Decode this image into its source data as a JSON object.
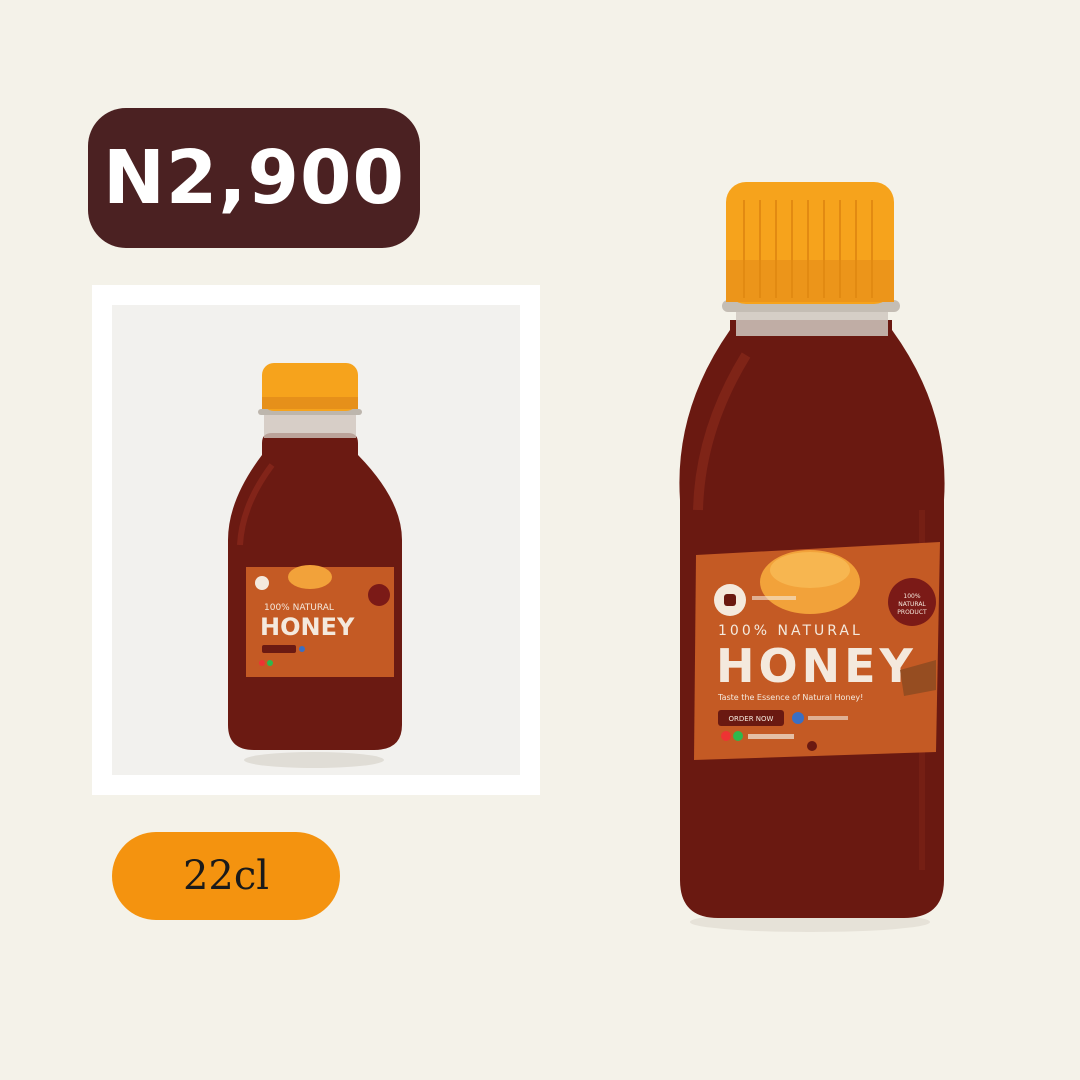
{
  "price": "N2,900",
  "volume": "22cl",
  "label": {
    "tagline": "100% NATURAL",
    "product_name": "HONEY",
    "badge": "100% NATURAL PRODUCT",
    "cta": "ORDER NOW",
    "subtitle": "Taste the Essence of Natural Honey!"
  },
  "colors": {
    "price_badge": "#4b2122",
    "volume_pill": "#f4930f",
    "background": "#f4f2e9",
    "cap": "#f6a31c",
    "honey": "#6e1a12",
    "label": "#c45a24"
  },
  "icons": [
    "phone-icon",
    "whatsapp-icon",
    "facebook-icon",
    "bee-logo-icon"
  ]
}
